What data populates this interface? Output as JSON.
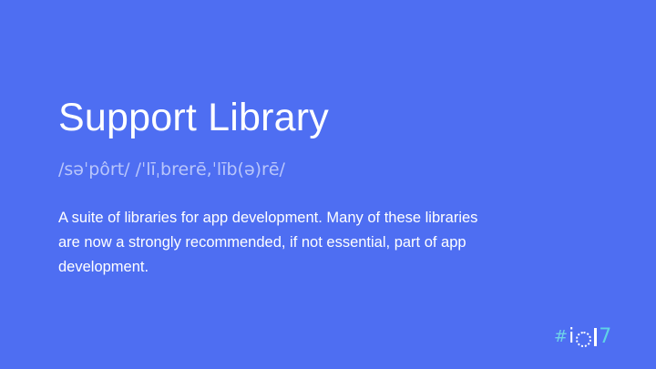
{
  "slide": {
    "title": "Support Library",
    "pronunciation": "/səˈpôrt/ /ˈlīˌbrerē,ˈlīb(ə)rē/",
    "description": "A suite of libraries for app development. Many of these libraries are now a strongly recommended, if not essential, part of app development."
  },
  "brand": {
    "hash": "#",
    "letter": "i",
    "seven": "7"
  },
  "colors": {
    "background": "#4e6ef2",
    "text": "#ffffff",
    "pronunciation": "#b9c6fb",
    "brand_accent": "#5fd3e6"
  }
}
